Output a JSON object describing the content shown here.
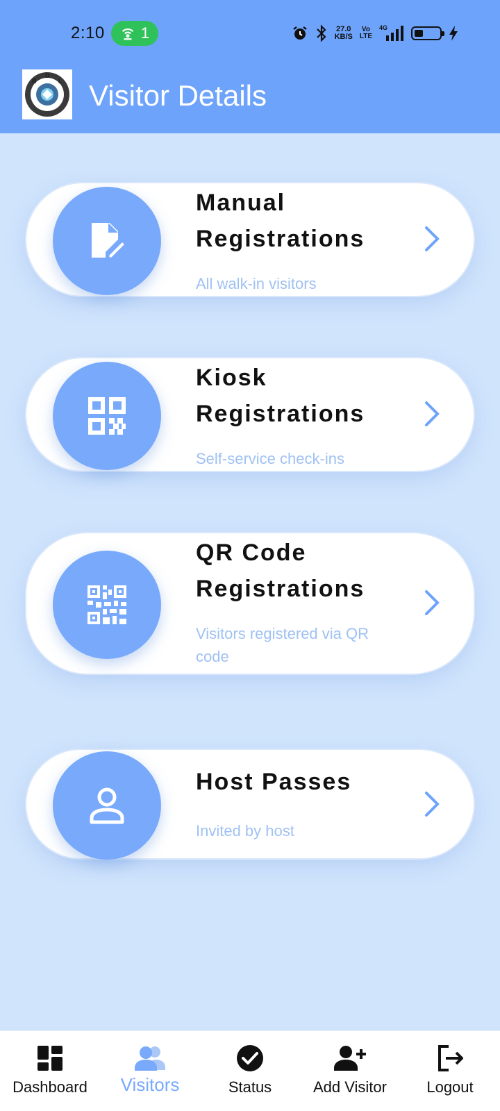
{
  "status_bar": {
    "time": "2:10",
    "hotspot_count": "1",
    "speed_top": "27.0",
    "speed_bottom": "KB/S",
    "volte_top": "Vo",
    "volte_bottom": "LTE",
    "network": "4G"
  },
  "header": {
    "title": "Visitor Details",
    "bg_color": "#6da3fb"
  },
  "cards": [
    {
      "title_line1": "Manual",
      "title_line2": "Registrations",
      "subtitle": "All walk-in visitors",
      "icon": "edit-document-icon"
    },
    {
      "title_line1": "Kiosk",
      "title_line2": "Registrations",
      "subtitle": "Self-service check-ins",
      "icon": "qr-grid-icon"
    },
    {
      "title_line1": "QR Code",
      "title_line2": "Registrations",
      "subtitle": "Visitors registered via QR code",
      "icon": "qr-code-icon"
    },
    {
      "title_line1": "Host Passes",
      "subtitle": "Invited by host",
      "icon": "person-icon"
    }
  ],
  "bottom_nav": {
    "items": [
      {
        "label": "Dashboard",
        "icon": "dashboard-icon"
      },
      {
        "label": "Visitors",
        "icon": "people-icon",
        "active": true
      },
      {
        "label": "Status",
        "icon": "check-circle-icon"
      },
      {
        "label": "Add Visitor",
        "icon": "add-person-icon"
      },
      {
        "label": "Logout",
        "icon": "logout-icon"
      }
    ]
  },
  "colors": {
    "accent": "#78a9fb",
    "background": "#d0e4fc",
    "subtitle": "#9fc1f3"
  }
}
